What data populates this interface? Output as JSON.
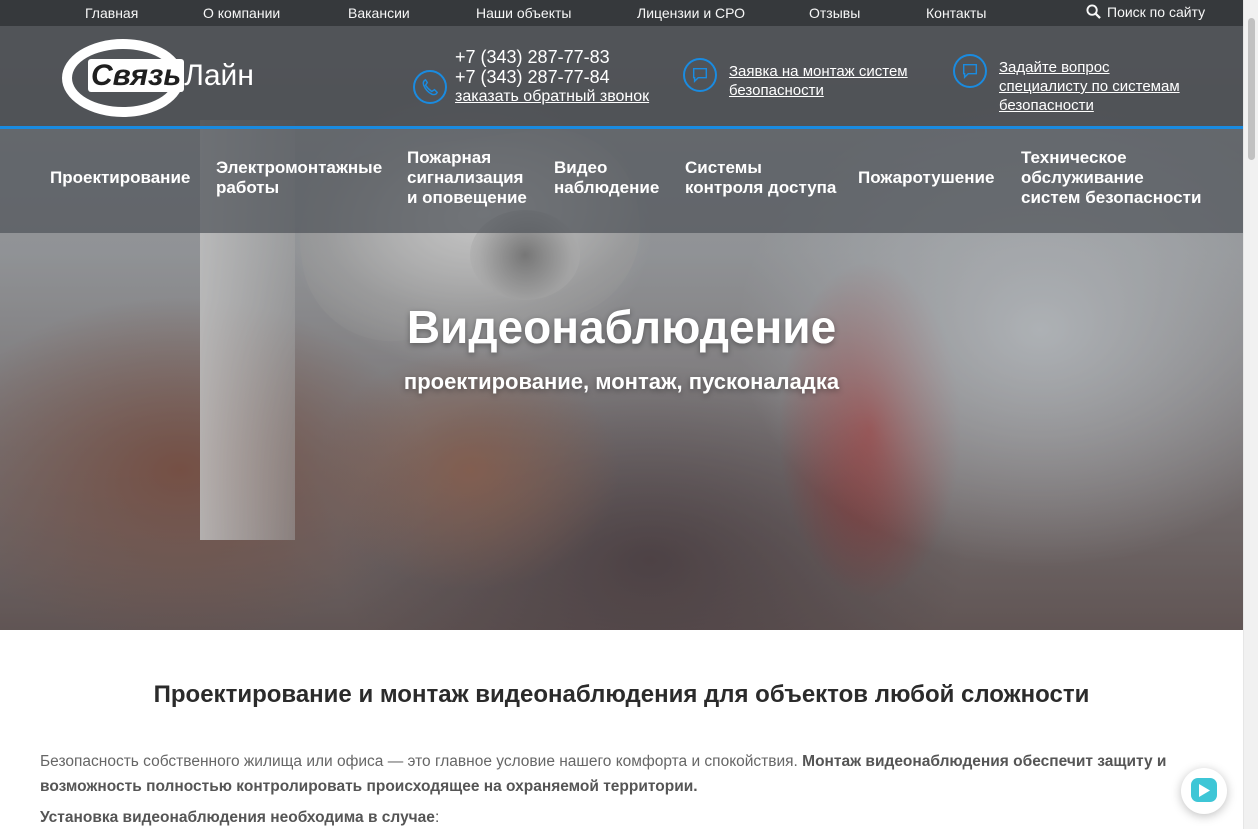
{
  "topnav": {
    "items": [
      "Главная",
      "О компании",
      "Вакансии",
      "Наши объекты",
      "Лицензии и СРО",
      "Отзывы",
      "Контакты"
    ],
    "search_label": "Поиск по сайту"
  },
  "header": {
    "logo_part1": "Связь",
    "logo_part2": "Лайн",
    "phone1": "+7 (343) 287-77-83",
    "phone2": "+7 (343) 287-77-84",
    "callback_link": "заказать обратный звонок",
    "request_link": "Заявка на монтаж систем безопасности",
    "question_link": "Задайте вопрос специалисту по системам безопасности"
  },
  "main_menu": {
    "items": [
      "Проектирование",
      "Электромонтажные\nработы",
      "Пожарная\nсигнализация\nи оповещение",
      "Видео\nнаблюдение",
      "Системы\nконтроля доступа",
      "Пожаротушение",
      "Техническое\nобслуживание\nсистем безопасности"
    ]
  },
  "hero": {
    "title": "Видеонаблюдение",
    "subtitle": "проектирование, монтаж, пусконаладка"
  },
  "content": {
    "heading": "Проектирование и монтаж видеонаблюдения для объектов любой сложности",
    "intro_plain": "Безопасность собственного жилища или офиса — это главное условие нашего комфорта и спокойствия. ",
    "intro_bold": "Монтаж видеонаблюдения обеспечит защиту и возможность полностью контролировать происходящее на охраняемой территории.",
    "install_bold": "Установка видеонаблюдения необходима в случае",
    "install_tail": ":"
  },
  "colors": {
    "accent": "#1a8be0",
    "topbar": "#2e3134",
    "chat": "#3ec6d6"
  },
  "icons": [
    "search-icon",
    "phone-icon",
    "chat-bubble-icon",
    "chat-widget-icon"
  ]
}
